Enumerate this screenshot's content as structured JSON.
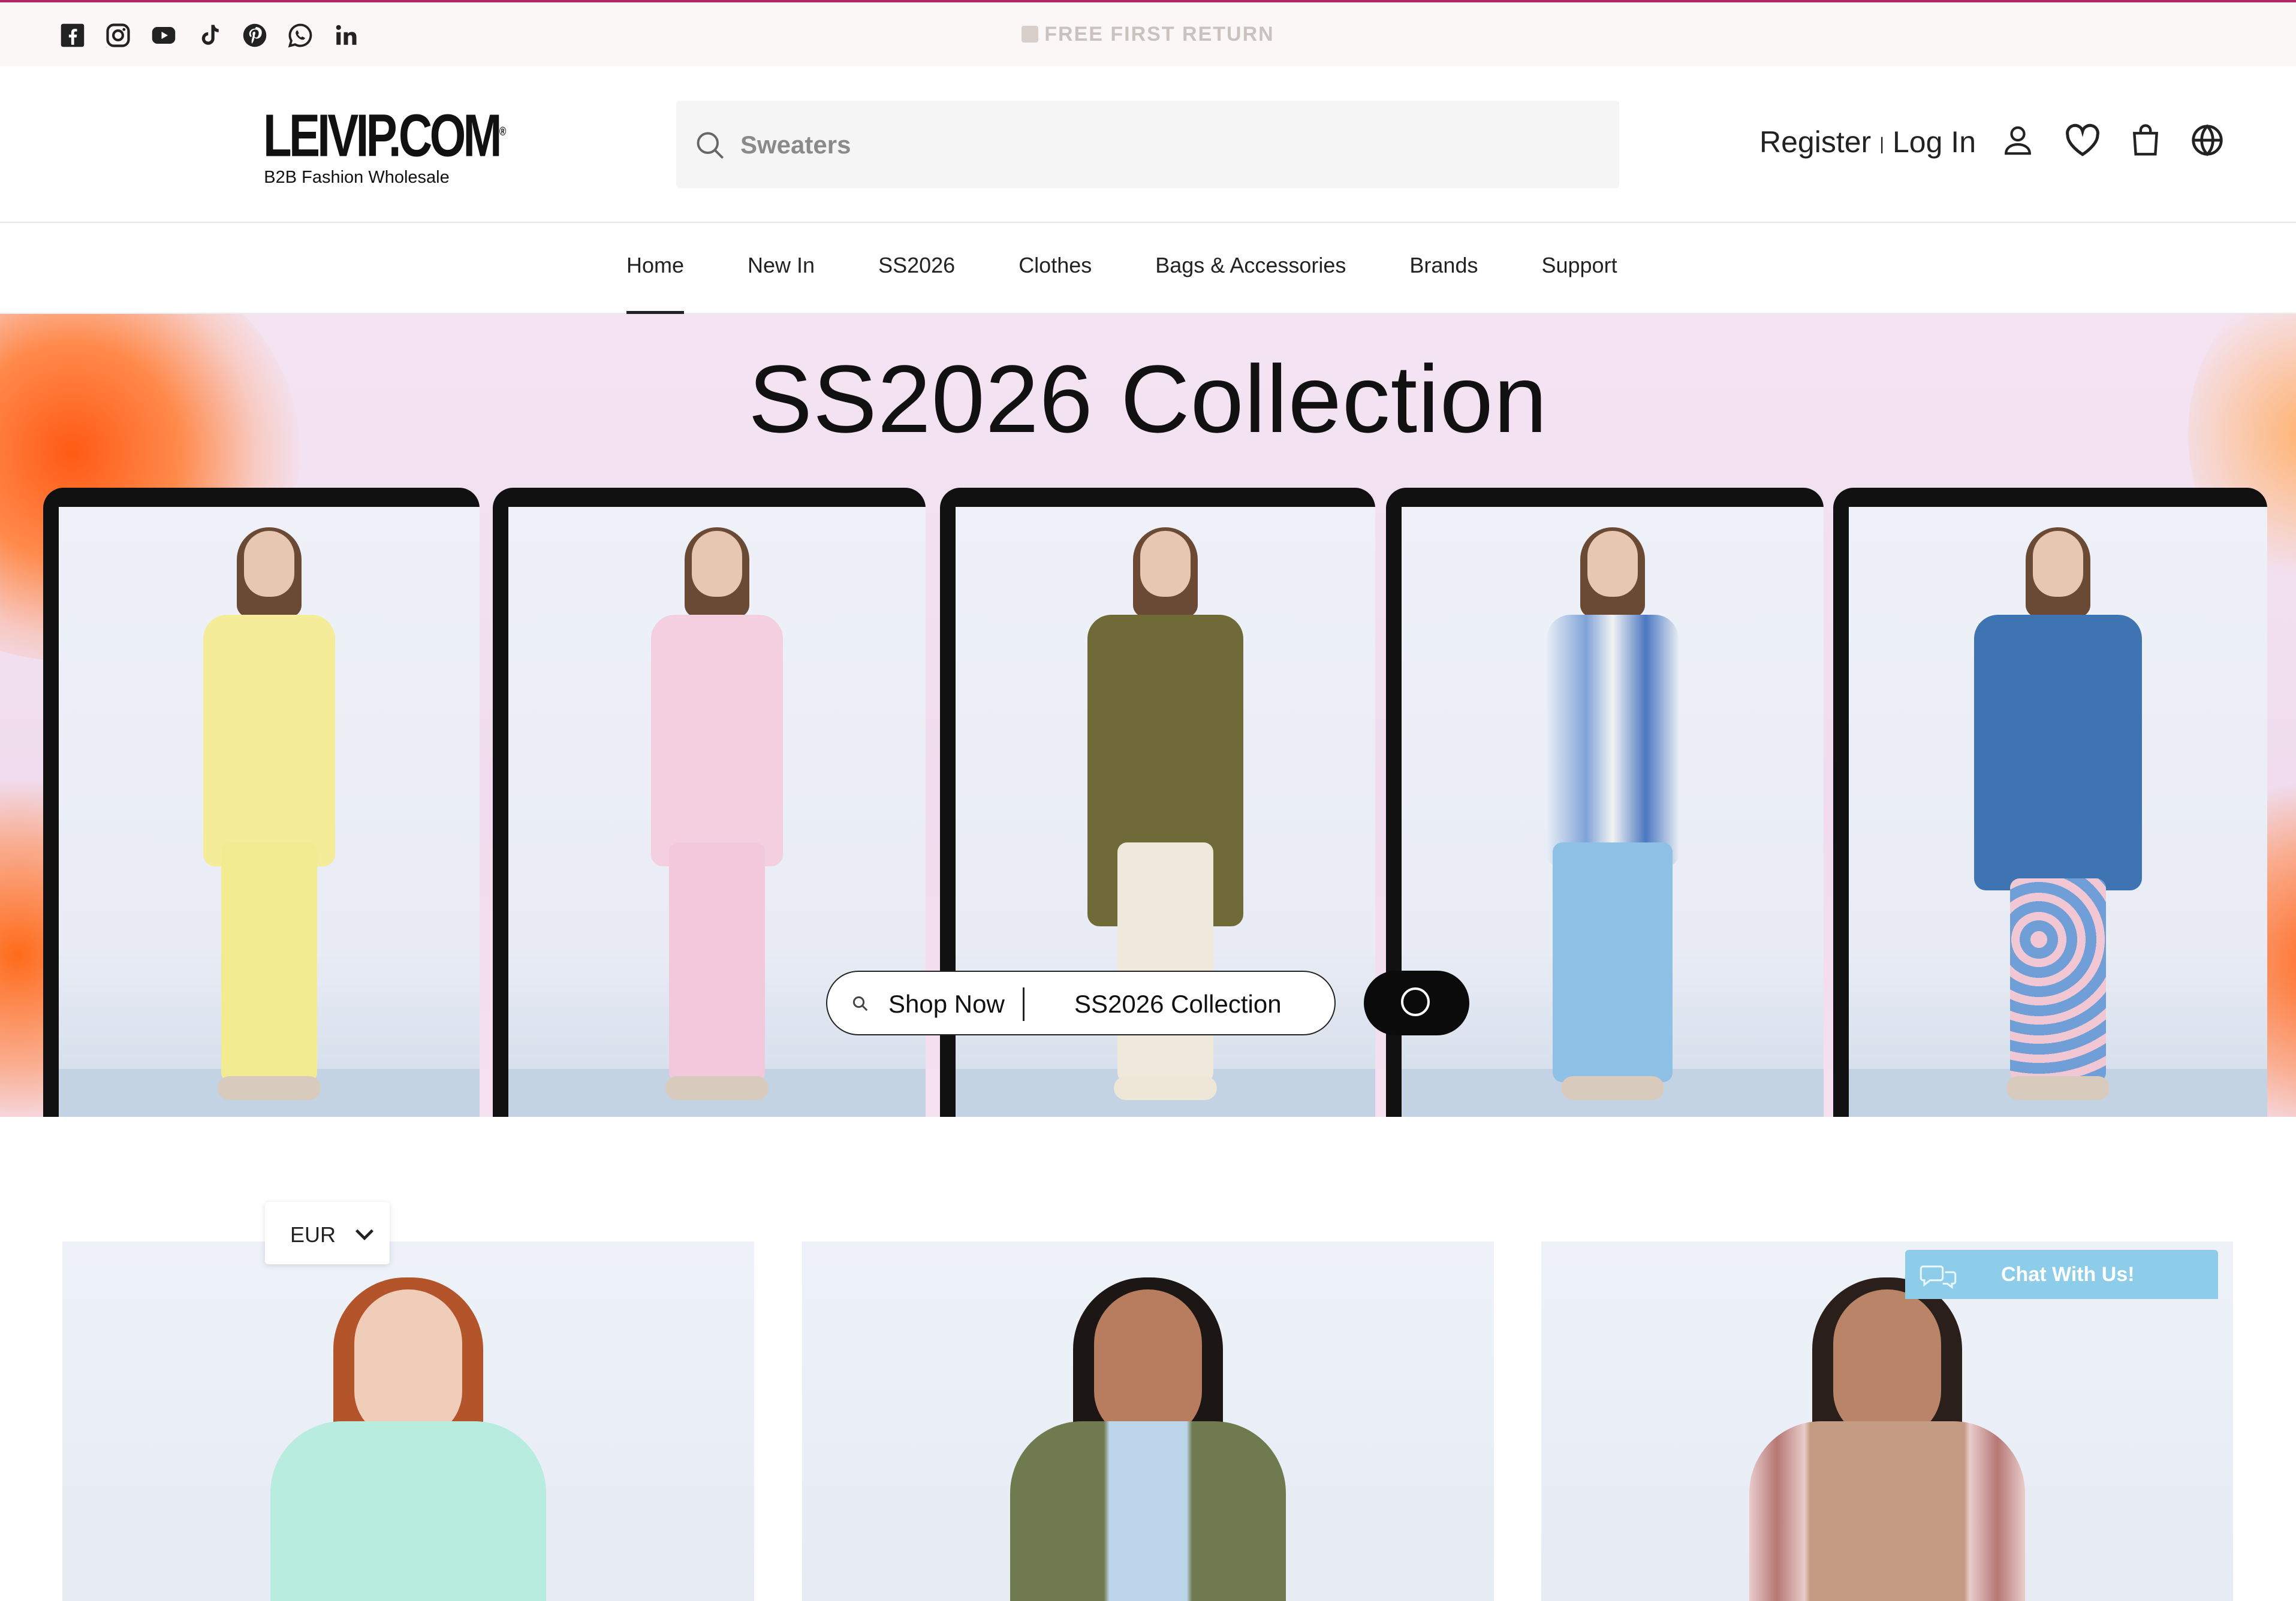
{
  "topbar": {
    "announcement": "FREE FIRST RETURN",
    "social_icons": [
      "facebook-icon",
      "instagram-icon",
      "youtube-icon",
      "tiktok-icon",
      "pinterest-icon",
      "whatsapp-icon",
      "linkedin-icon"
    ],
    "accent_color": "#b0266b"
  },
  "header": {
    "logo": "LEIVIP.COM",
    "logo_mark": "®",
    "tagline": "B2B Fashion Wholesale",
    "search_placeholder": "Sweaters",
    "register": "Register",
    "separator": "|",
    "login": "Log In",
    "icons": [
      "user-icon",
      "heart-icon",
      "bag-icon",
      "globe-icon"
    ]
  },
  "nav": {
    "items": [
      "Home",
      "New In",
      "SS2026",
      "Clothes",
      "Bags & Accessories",
      "Brands",
      "Support"
    ],
    "active": "Home"
  },
  "hero": {
    "title": "SS2026 Collection",
    "shop_now": "Shop Now",
    "collection_label": "SS2026 Collection"
  },
  "currency": {
    "value": "EUR"
  },
  "chat": {
    "label": "Chat With Us!",
    "color": "#8ecdea"
  }
}
